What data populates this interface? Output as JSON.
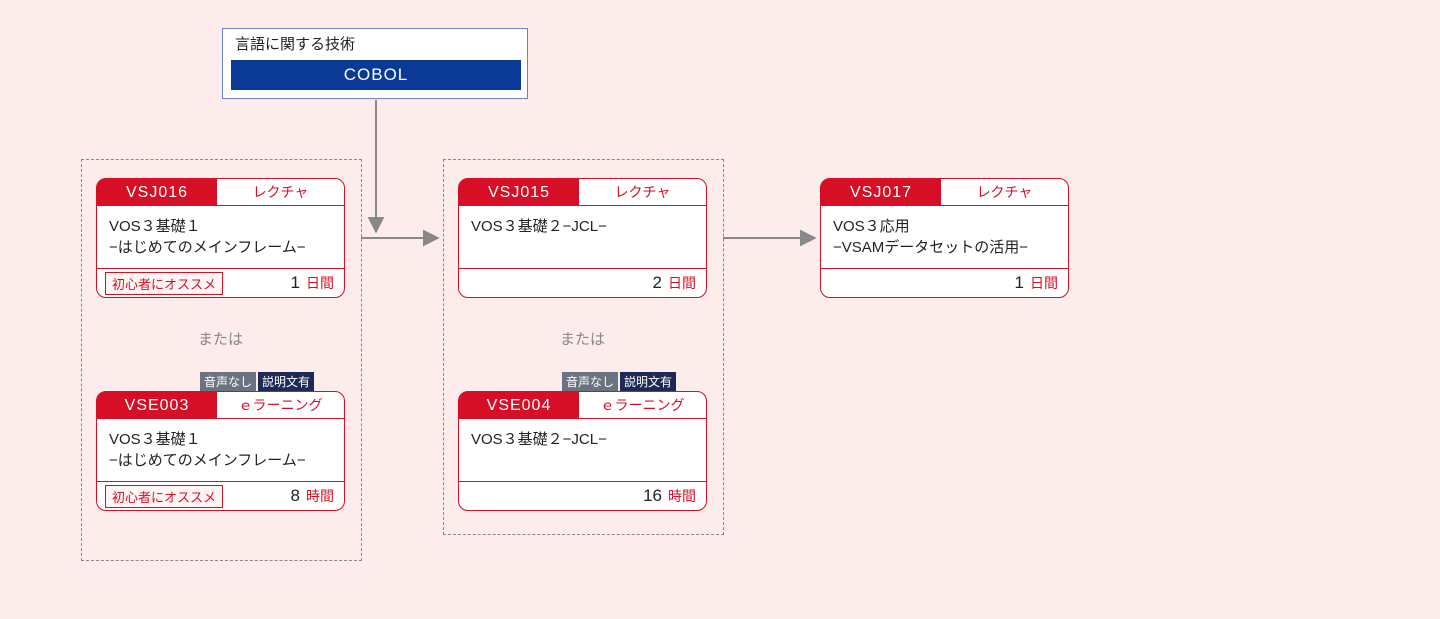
{
  "header": {
    "title": "言語に関する技術",
    "bar": "COBOL"
  },
  "separators": {
    "s1": "または",
    "s2": "または"
  },
  "tags": {
    "no_audio": "音声なし",
    "has_desc": "説明文有"
  },
  "cards": {
    "c1": {
      "code": "VSJ016",
      "type": "レクチャ",
      "title_l1": "VOS３基礎１",
      "title_l2": "−はじめてのメインフレーム−",
      "recommend": "初心者にオススメ",
      "dur_num": "1",
      "dur_unit": "日間"
    },
    "c2": {
      "code": "VSE003",
      "type": "ｅラーニング",
      "title_l1": "VOS３基礎１",
      "title_l2": "−はじめてのメインフレーム−",
      "recommend": "初心者にオススメ",
      "dur_num": "8",
      "dur_unit": "時間"
    },
    "c3": {
      "code": "VSJ015",
      "type": "レクチャ",
      "title_l1": "VOS３基礎２−JCL−",
      "title_l2": "",
      "recommend": "",
      "dur_num": "2",
      "dur_unit": "日間"
    },
    "c4": {
      "code": "VSE004",
      "type": "ｅラーニング",
      "title_l1": "VOS３基礎２−JCL−",
      "title_l2": "",
      "recommend": "",
      "dur_num": "16",
      "dur_unit": "時間"
    },
    "c5": {
      "code": "VSJ017",
      "type": "レクチャ",
      "title_l1": "VOS３応用",
      "title_l2": "−VSAMデータセットの活用−",
      "recommend": "",
      "dur_num": "1",
      "dur_unit": "日間"
    }
  }
}
